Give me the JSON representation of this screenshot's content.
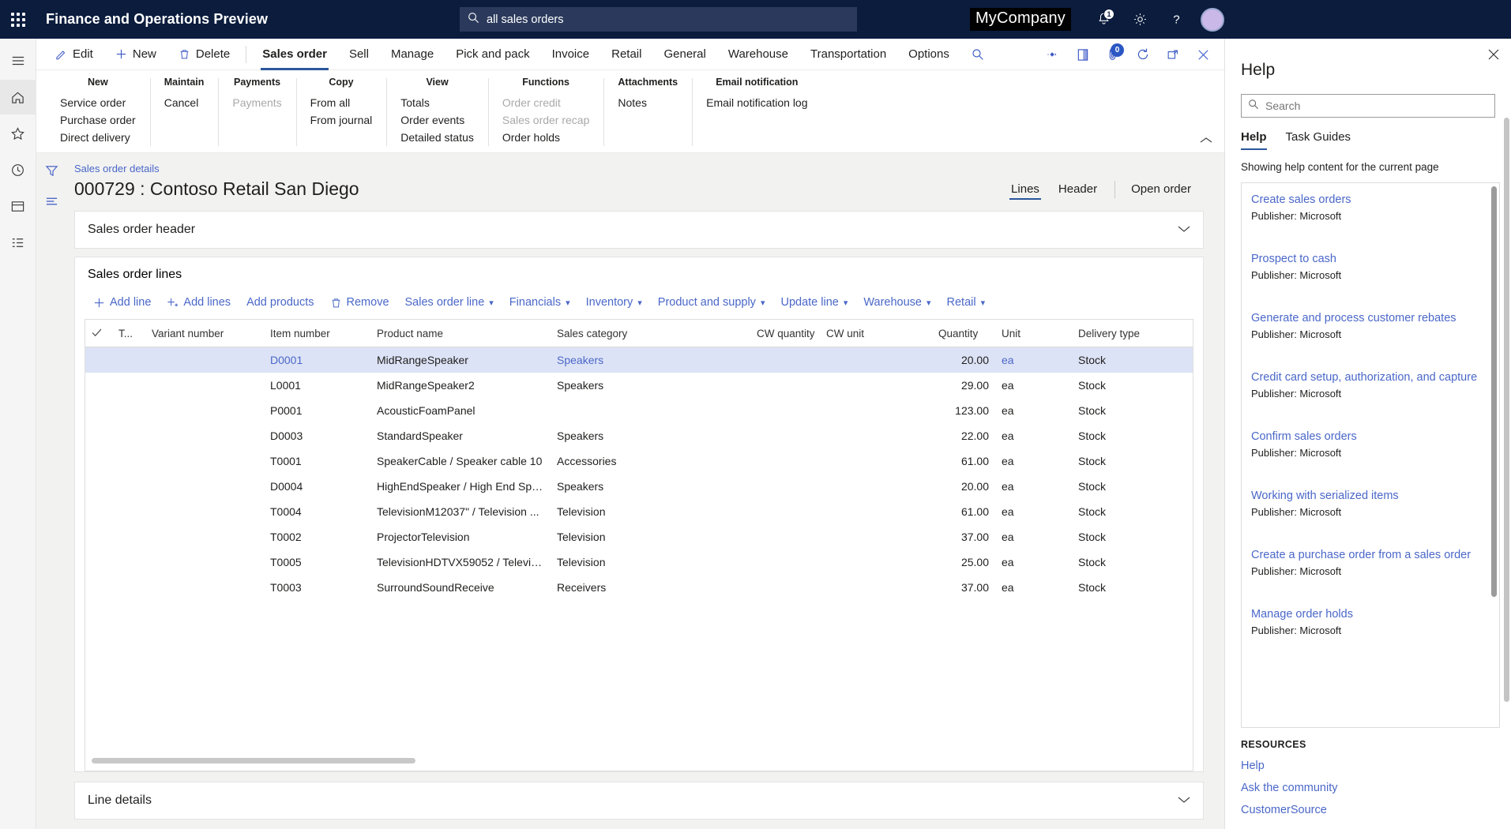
{
  "topbar": {
    "waffle_icon": "app-launcher-icon",
    "app_title": "Finance and Operations Preview",
    "search_value": "all sales orders",
    "search_icon": "search-icon",
    "company": "MyCompany",
    "notification_badge": "1",
    "icons": [
      "notification-bell-icon",
      "settings-gear-icon",
      "help-question-icon",
      "user-avatar"
    ]
  },
  "ribbon": {
    "commands": [
      {
        "label": "Edit",
        "icon": "pencil-icon"
      },
      {
        "label": "New",
        "icon": "plus-icon"
      },
      {
        "label": "Delete",
        "icon": "trash-icon"
      }
    ],
    "tabs": [
      {
        "label": "Sales order",
        "active": true
      },
      {
        "label": "Sell",
        "active": false
      },
      {
        "label": "Manage",
        "active": false
      },
      {
        "label": "Pick and pack",
        "active": false
      },
      {
        "label": "Invoice",
        "active": false
      },
      {
        "label": "Retail",
        "active": false
      },
      {
        "label": "General",
        "active": false
      },
      {
        "label": "Warehouse",
        "active": false
      },
      {
        "label": "Transportation",
        "active": false
      },
      {
        "label": "Options",
        "active": false
      }
    ],
    "search_icon": "search-icon",
    "right_icons": [
      {
        "name": "shortcut-diamond-icon"
      },
      {
        "name": "side-panel-icon"
      },
      {
        "name": "attachments-icon",
        "badge": "0"
      },
      {
        "name": "refresh-icon"
      },
      {
        "name": "open-in-new-window-icon"
      },
      {
        "name": "close-icon"
      }
    ],
    "collapse_icon": "chevron-up-icon",
    "groups": [
      {
        "title": "New",
        "items": [
          {
            "label": "Service order",
            "disabled": false
          },
          {
            "label": "Purchase order",
            "disabled": false
          },
          {
            "label": "Direct delivery",
            "disabled": false
          }
        ]
      },
      {
        "title": "Maintain",
        "items": [
          {
            "label": "Cancel",
            "disabled": false
          }
        ]
      },
      {
        "title": "Payments",
        "items": [
          {
            "label": "Payments",
            "disabled": true
          }
        ]
      },
      {
        "title": "Copy",
        "items": [
          {
            "label": "From all",
            "disabled": false
          },
          {
            "label": "From journal",
            "disabled": false
          }
        ]
      },
      {
        "title": "View",
        "items": [
          {
            "label": "Totals",
            "disabled": false
          },
          {
            "label": "Order events",
            "disabled": false
          },
          {
            "label": "Detailed status",
            "disabled": false
          }
        ]
      },
      {
        "title": "Functions",
        "items": [
          {
            "label": "Order credit",
            "disabled": true
          },
          {
            "label": "Sales order recap",
            "disabled": true
          },
          {
            "label": "Order holds",
            "disabled": false
          }
        ]
      },
      {
        "title": "Attachments",
        "items": [
          {
            "label": "Notes",
            "disabled": false
          }
        ]
      },
      {
        "title": "Email notification",
        "items": [
          {
            "label": "Email notification log",
            "disabled": false
          }
        ]
      }
    ]
  },
  "rail": {
    "items": [
      {
        "name": "hamburger-menu-icon"
      },
      {
        "name": "home-icon"
      },
      {
        "name": "favorites-star-icon"
      },
      {
        "name": "recent-clock-icon"
      },
      {
        "name": "workspaces-icon"
      },
      {
        "name": "modules-list-icon"
      }
    ]
  },
  "sidetool": {
    "items": [
      {
        "name": "filter-icon"
      },
      {
        "name": "list-view-icon"
      }
    ]
  },
  "page": {
    "breadcrumb": "Sales order details",
    "title": "000729 : Contoso Retail San Diego",
    "tabs": [
      {
        "label": "Lines",
        "active": true
      },
      {
        "label": "Header",
        "active": false
      }
    ],
    "open_order": "Open order"
  },
  "sections": {
    "header_card": {
      "title": "Sales order header",
      "chevron": "chevron-down-icon"
    },
    "lines_card": {
      "title": "Sales order lines"
    },
    "line_details": {
      "title": "Line details",
      "chevron": "chevron-down-icon"
    }
  },
  "grid_toolbar": [
    {
      "label": "Add line",
      "icon": "plus-icon",
      "caret": false
    },
    {
      "label": "Add lines",
      "icon": "plus-lines-icon",
      "caret": false
    },
    {
      "label": "Add products",
      "icon": "",
      "caret": false
    },
    {
      "label": "Remove",
      "icon": "trash-icon",
      "caret": false
    },
    {
      "label": "Sales order line",
      "icon": "",
      "caret": true
    },
    {
      "label": "Financials",
      "icon": "",
      "caret": true
    },
    {
      "label": "Inventory",
      "icon": "",
      "caret": true
    },
    {
      "label": "Product and supply",
      "icon": "",
      "caret": true
    },
    {
      "label": "Update line",
      "icon": "",
      "caret": true
    },
    {
      "label": "Warehouse",
      "icon": "",
      "caret": true
    },
    {
      "label": "Retail",
      "icon": "",
      "caret": true
    }
  ],
  "table": {
    "columns": [
      "",
      "T...",
      "Variant number",
      "Item number",
      "Product name",
      "Sales category",
      "CW quantity",
      "CW unit",
      "Quantity",
      "Unit",
      "Delivery type"
    ],
    "select_all_icon": "checkmark-icon",
    "rows": [
      {
        "selected": true,
        "t": "",
        "variant": "",
        "item": "D0001",
        "product": "MidRangeSpeaker",
        "category": "Speakers",
        "cw_qty": "",
        "cw_unit": "",
        "qty": "20.00",
        "unit": "ea",
        "delivery": "Stock"
      },
      {
        "selected": false,
        "t": "",
        "variant": "",
        "item": "L0001",
        "product": "MidRangeSpeaker2",
        "category": "Speakers",
        "cw_qty": "",
        "cw_unit": "",
        "qty": "29.00",
        "unit": "ea",
        "delivery": "Stock"
      },
      {
        "selected": false,
        "t": "",
        "variant": "",
        "item": "P0001",
        "product": "AcousticFoamPanel",
        "category": "",
        "cw_qty": "",
        "cw_unit": "",
        "qty": "123.00",
        "unit": "ea",
        "delivery": "Stock"
      },
      {
        "selected": false,
        "t": "",
        "variant": "",
        "item": "D0003",
        "product": "StandardSpeaker",
        "category": "Speakers",
        "cw_qty": "",
        "cw_unit": "",
        "qty": "22.00",
        "unit": "ea",
        "delivery": "Stock"
      },
      {
        "selected": false,
        "t": "",
        "variant": "",
        "item": "T0001",
        "product": "SpeakerCable / Speaker cable 10",
        "category": "Accessories",
        "cw_qty": "",
        "cw_unit": "",
        "qty": "61.00",
        "unit": "ea",
        "delivery": "Stock"
      },
      {
        "selected": false,
        "t": "",
        "variant": "",
        "item": "D0004",
        "product": "HighEndSpeaker / High End Spe...",
        "category": "Speakers",
        "cw_qty": "",
        "cw_unit": "",
        "qty": "20.00",
        "unit": "ea",
        "delivery": "Stock"
      },
      {
        "selected": false,
        "t": "",
        "variant": "",
        "item": "T0004",
        "product": "TelevisionM12037\" / Television ...",
        "category": "Television",
        "cw_qty": "",
        "cw_unit": "",
        "qty": "61.00",
        "unit": "ea",
        "delivery": "Stock"
      },
      {
        "selected": false,
        "t": "",
        "variant": "",
        "item": "T0002",
        "product": "ProjectorTelevision",
        "category": "Television",
        "cw_qty": "",
        "cw_unit": "",
        "qty": "37.00",
        "unit": "ea",
        "delivery": "Stock"
      },
      {
        "selected": false,
        "t": "",
        "variant": "",
        "item": "T0005",
        "product": "TelevisionHDTVX59052 / Televisi...",
        "category": "Television",
        "cw_qty": "",
        "cw_unit": "",
        "qty": "25.00",
        "unit": "ea",
        "delivery": "Stock"
      },
      {
        "selected": false,
        "t": "",
        "variant": "",
        "item": "T0003",
        "product": "SurroundSoundReceive",
        "category": "Receivers",
        "cw_qty": "",
        "cw_unit": "",
        "qty": "37.00",
        "unit": "ea",
        "delivery": "Stock"
      }
    ]
  },
  "help": {
    "title": "Help",
    "close_icon": "close-icon",
    "search_placeholder": "Search",
    "search_icon": "search-icon",
    "tabs": [
      {
        "label": "Help",
        "active": true
      },
      {
        "label": "Task Guides",
        "active": false
      }
    ],
    "note": "Showing help content for the current page",
    "publisher_label": "Publisher: Microsoft",
    "items": [
      {
        "title": "Create sales orders",
        "publisher": "Publisher: Microsoft"
      },
      {
        "title": "Prospect to cash",
        "publisher": "Publisher: Microsoft"
      },
      {
        "title": "Generate and process customer rebates",
        "publisher": "Publisher: Microsoft"
      },
      {
        "title": "Credit card setup, authorization, and capture",
        "publisher": "Publisher: Microsoft"
      },
      {
        "title": "Confirm sales orders",
        "publisher": "Publisher: Microsoft"
      },
      {
        "title": "Working with serialized items",
        "publisher": "Publisher: Microsoft"
      },
      {
        "title": "Create a purchase order from a sales order",
        "publisher": "Publisher: Microsoft"
      },
      {
        "title": "Manage order holds",
        "publisher": "Publisher: Microsoft"
      }
    ],
    "resources_heading": "RESOURCES",
    "resources": [
      {
        "label": "Help"
      },
      {
        "label": "Ask the community"
      },
      {
        "label": "CustomerSource"
      }
    ]
  },
  "colors": {
    "topbar_bg": "#0b1c3d",
    "accent_link": "#4a67c8",
    "tab_underline": "#2b579a",
    "row_selected": "#dde3f6"
  }
}
